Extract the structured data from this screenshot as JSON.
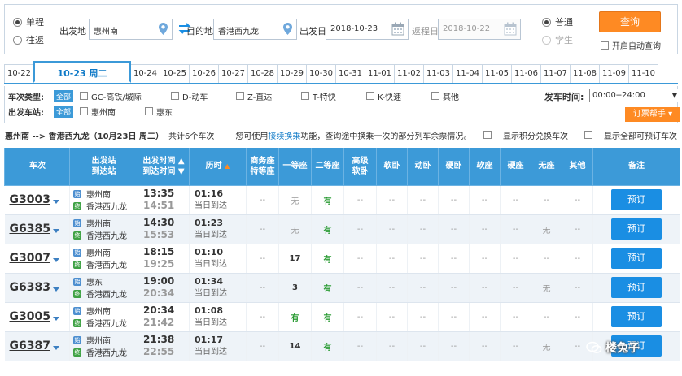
{
  "search": {
    "trip_types": [
      {
        "label": "单程",
        "checked": true
      },
      {
        "label": "往返",
        "checked": false
      }
    ],
    "from_label": "出发地",
    "from_value": "惠州南",
    "to_label": "目的地",
    "to_value": "香港西九龙",
    "date_label": "出发日",
    "date_value": "2018-10-23",
    "return_label": "返程日",
    "return_value": "2018-10-22",
    "ticket_types": [
      {
        "label": "普通",
        "checked": true
      },
      {
        "label": "学生",
        "checked": false
      }
    ],
    "query_label": "查询",
    "auto_query_label": "开启自动查询"
  },
  "dates": [
    "10-22",
    "10-23 周二",
    "10-24",
    "10-25",
    "10-26",
    "10-27",
    "10-28",
    "10-29",
    "10-30",
    "10-31",
    "11-01",
    "11-02",
    "11-03",
    "11-04",
    "11-05",
    "11-06",
    "11-07",
    "11-08",
    "11-09",
    "11-10"
  ],
  "active_date_index": 1,
  "filters": {
    "type_label": "车次类型:",
    "all_label": "全部",
    "types": [
      "GC-高铁/城际",
      "D-动车",
      "Z-直达",
      "T-特快",
      "K-快速",
      "其他"
    ],
    "station_label": "出发车站:",
    "stations": [
      "惠州南",
      "惠东"
    ],
    "depart_time_label": "发车时间:",
    "depart_time_value": "00:00--24:00",
    "helper_label": "订票帮手"
  },
  "summary": {
    "route": "惠州南 --> 香港西九龙（10月23日 周二）",
    "count": "共计6个车次",
    "tip_pre": "您可使用",
    "tip_link": "接续换乘",
    "tip_post": "功能，查询途中换乘一次的部分列车余票情况。",
    "opt1": "显示积分兑换车次",
    "opt2": "显示全部可预订车次"
  },
  "columns": {
    "train": "车次",
    "station_a": "出发站",
    "station_b": "到达站",
    "time_a": "出发时间",
    "time_b": "到达时间",
    "duration": "历时",
    "business_a": "商务座",
    "business_b": "特等座",
    "first": "一等座",
    "second": "二等座",
    "hisoft_a": "高级",
    "hisoft_b": "软卧",
    "softsleeper": "软卧",
    "dynsleeper": "动卧",
    "hardsleeper": "硬卧",
    "softseat": "软座",
    "hardseat": "硬座",
    "noseat": "无座",
    "other": "其他",
    "remark": "备注"
  },
  "trains": [
    {
      "no": "G3003",
      "from": "惠州南",
      "to": "香港西九龙",
      "dep": "13:35",
      "arr": "14:51",
      "dur": "01:16",
      "arrive_day": "当日到达",
      "business": "--",
      "first": "无",
      "second": "有",
      "hisoft": "--",
      "softsleeper": "--",
      "dynsleeper": "--",
      "hardsleeper": "--",
      "softseat": "--",
      "hardseat": "--",
      "noseat": "--",
      "other": "--",
      "book": "预订"
    },
    {
      "no": "G6385",
      "from": "惠州南",
      "to": "香港西九龙",
      "dep": "14:30",
      "arr": "15:53",
      "dur": "01:23",
      "arrive_day": "当日到达",
      "business": "--",
      "first": "无",
      "second": "有",
      "hisoft": "--",
      "softsleeper": "--",
      "dynsleeper": "--",
      "hardsleeper": "--",
      "softseat": "--",
      "hardseat": "--",
      "noseat": "无",
      "other": "--",
      "book": "预订"
    },
    {
      "no": "G3007",
      "from": "惠州南",
      "to": "香港西九龙",
      "dep": "18:15",
      "arr": "19:25",
      "dur": "01:10",
      "arrive_day": "当日到达",
      "business": "--",
      "first": "17",
      "second": "有",
      "hisoft": "--",
      "softsleeper": "--",
      "dynsleeper": "--",
      "hardsleeper": "--",
      "softseat": "--",
      "hardseat": "--",
      "noseat": "--",
      "other": "--",
      "book": "预订"
    },
    {
      "no": "G6383",
      "from": "惠东",
      "to": "香港西九龙",
      "dep": "19:00",
      "arr": "20:34",
      "dur": "01:34",
      "arrive_day": "当日到达",
      "business": "--",
      "first": "3",
      "second": "有",
      "hisoft": "--",
      "softsleeper": "--",
      "dynsleeper": "--",
      "hardsleeper": "--",
      "softseat": "--",
      "hardseat": "--",
      "noseat": "无",
      "other": "--",
      "book": "预订"
    },
    {
      "no": "G3005",
      "from": "惠州南",
      "to": "香港西九龙",
      "dep": "20:34",
      "arr": "21:42",
      "dur": "01:08",
      "arrive_day": "当日到达",
      "business": "--",
      "first": "有",
      "second": "有",
      "hisoft": "--",
      "softsleeper": "--",
      "dynsleeper": "--",
      "hardsleeper": "--",
      "softseat": "--",
      "hardseat": "--",
      "noseat": "--",
      "other": "--",
      "book": "预订"
    },
    {
      "no": "G6387",
      "from": "惠州南",
      "to": "香港西九龙",
      "dep": "21:38",
      "arr": "22:55",
      "dur": "01:17",
      "arrive_day": "当日到达",
      "business": "--",
      "first": "14",
      "second": "有",
      "hisoft": "--",
      "softsleeper": "--",
      "dynsleeper": "--",
      "hardsleeper": "--",
      "softseat": "--",
      "hardseat": "--",
      "noseat": "无",
      "other": "--",
      "book": "预订"
    }
  ],
  "badges": {
    "start": "始",
    "end": "终"
  },
  "watermark": "楼兔子",
  "colors": {
    "accent": "#3c9ad8",
    "orange": "#fe8a23",
    "book": "#1a8ee3",
    "available": "#2a9b33"
  }
}
